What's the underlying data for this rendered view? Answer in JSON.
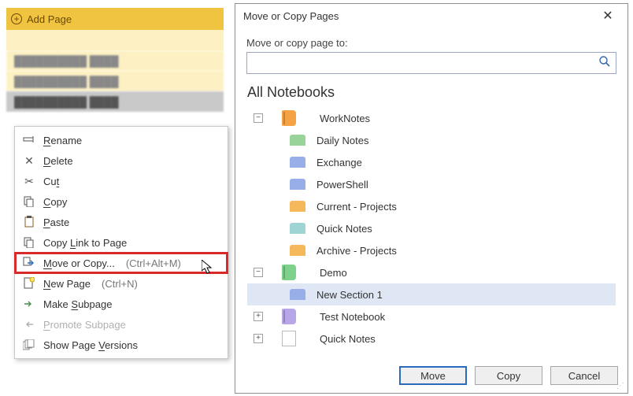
{
  "addPage": {
    "label": "Add Page"
  },
  "pages": [
    {
      "label": "██████████ ████"
    },
    {
      "label": "██████████ ████"
    },
    {
      "label": "██████████ ████"
    }
  ],
  "contextMenu": {
    "rename": {
      "prefix": "R",
      "rest": "ename"
    },
    "delete": {
      "prefix": "D",
      "rest": "elete"
    },
    "cut": {
      "prefix": "t",
      "before": "Cu"
    },
    "copy": {
      "prefix": "C",
      "rest": "opy"
    },
    "paste": {
      "prefix": "P",
      "rest": "aste"
    },
    "copyLink": {
      "prefix": "L",
      "before": "Copy ",
      "rest": "ink to Page"
    },
    "moveCopy": {
      "prefix": "M",
      "rest": "ove or Copy...",
      "shortcut": "(Ctrl+Alt+M)"
    },
    "newPage": {
      "prefix": "N",
      "rest": "ew Page",
      "shortcut": "(Ctrl+N)"
    },
    "subpage": {
      "prefix": "S",
      "before": "Make ",
      "rest": "ubpage"
    },
    "promote": {
      "prefix": "P",
      "rest": "romote Subpage"
    },
    "versions": {
      "prefix": "V",
      "before": "Show Page ",
      "rest": "ersions"
    }
  },
  "dialog": {
    "title": "Move or Copy Pages",
    "prompt": "Move or copy page to:",
    "searchPlaceholder": "",
    "treeHeader": "All Notebooks",
    "notebooks": [
      {
        "name": "WorkNotes",
        "colorClass": "nb-orange",
        "expanded": true,
        "sections": [
          {
            "name": "Daily Notes",
            "sc": "sec-green"
          },
          {
            "name": "Exchange",
            "sc": "sec-blue"
          },
          {
            "name": "PowerShell",
            "sc": "sec-blue"
          },
          {
            "name": "Current - Projects",
            "sc": "sec-orange"
          },
          {
            "name": "Quick Notes",
            "sc": "sec-teal"
          },
          {
            "name": "Archive - Projects",
            "sc": "sec-orange"
          }
        ]
      },
      {
        "name": "Demo",
        "colorClass": "nb-green",
        "expanded": true,
        "sections": [
          {
            "name": "New Section 1",
            "sc": "sec-blue",
            "selected": true
          }
        ]
      },
      {
        "name": "Test Notebook",
        "colorClass": "nb-lav",
        "expanded": false
      },
      {
        "name": "Quick Notes",
        "isQuickNotes": true,
        "expanded": false
      }
    ],
    "buttons": {
      "move": "Move",
      "copy": "Copy",
      "cancel": "Cancel"
    }
  }
}
